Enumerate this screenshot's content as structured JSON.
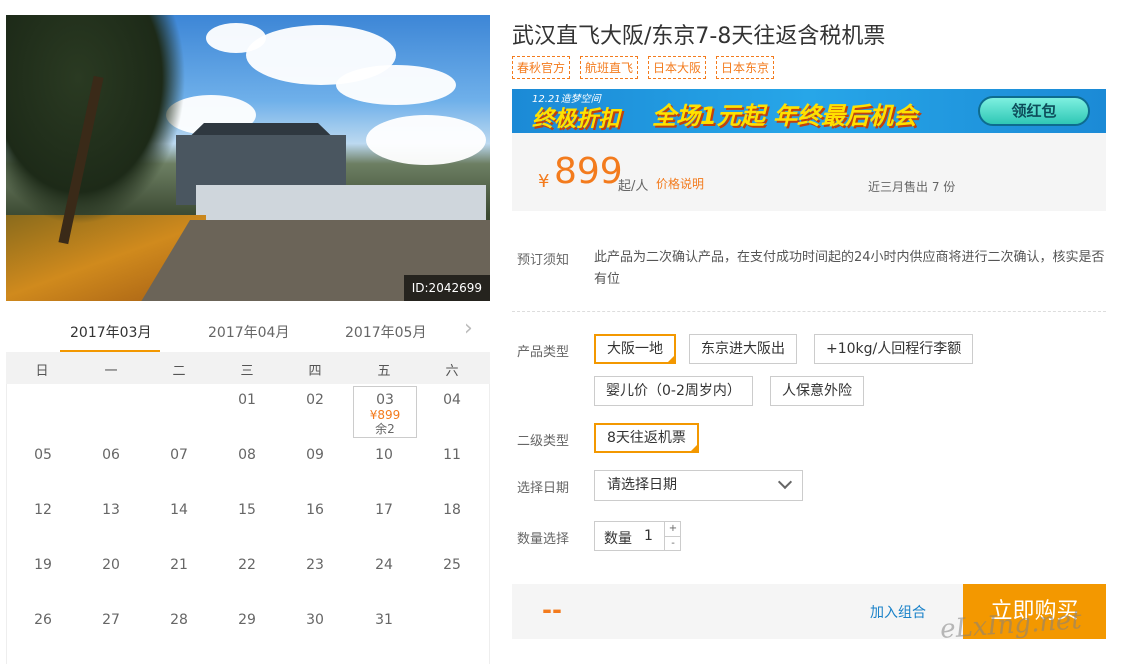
{
  "photo": {
    "id_label": "ID:2042699"
  },
  "calendar": {
    "tabs": [
      "2017年03月",
      "2017年04月",
      "2017年05月"
    ],
    "weekdays": [
      "日",
      "一",
      "二",
      "三",
      "四",
      "五",
      "六"
    ],
    "rows": [
      [
        "",
        "",
        "",
        "01",
        "02",
        "03",
        "04"
      ],
      [
        "05",
        "06",
        "07",
        "08",
        "09",
        "10",
        "11"
      ],
      [
        "12",
        "13",
        "14",
        "15",
        "16",
        "17",
        "18"
      ],
      [
        "19",
        "20",
        "21",
        "22",
        "23",
        "24",
        "25"
      ],
      [
        "26",
        "27",
        "28",
        "29",
        "30",
        "31",
        ""
      ]
    ],
    "selected_day": {
      "day": "03",
      "price": "¥899",
      "remain": "余2"
    }
  },
  "product": {
    "title": "武汉直飞大阪/东京7-8天往返含税机票",
    "tags": [
      "春秋官方",
      "航班直飞",
      "日本大阪",
      "日本东京"
    ],
    "banner": {
      "sub": "12.21造梦空间",
      "main": "终极折扣",
      "middle": "全场1元起  年终最后机会",
      "button": "领红包"
    },
    "price": {
      "currency": "¥",
      "amount": "899",
      "unit": "起/人",
      "explain_link": "价格说明",
      "sold": "近三月售出 7 份"
    },
    "notice": {
      "label": "预订须知",
      "text": "此产品为二次确认产品，在支付成功时间起的24小时内供应商将进行二次确认，核实是否有位"
    },
    "product_type": {
      "label": "产品类型",
      "options": [
        "大阪一地",
        "东京进大阪出",
        "+10kg/人回程行李额",
        "婴儿价（0-2周岁内）",
        "人保意外险"
      ]
    },
    "sub_type": {
      "label": "二级类型",
      "options": [
        "8天往返机票"
      ]
    },
    "date": {
      "label": "选择日期",
      "placeholder": "请选择日期"
    },
    "quantity": {
      "label": "数量选择",
      "field_label": "数量",
      "value": "1",
      "plus": "+",
      "minus": "-"
    },
    "bottom": {
      "total": "--",
      "add_combo": "加入组合",
      "buy": "立即购买"
    }
  },
  "watermark": "eLxIng.net",
  "accent_color": "#f39800",
  "price_color": "#f37b1d"
}
